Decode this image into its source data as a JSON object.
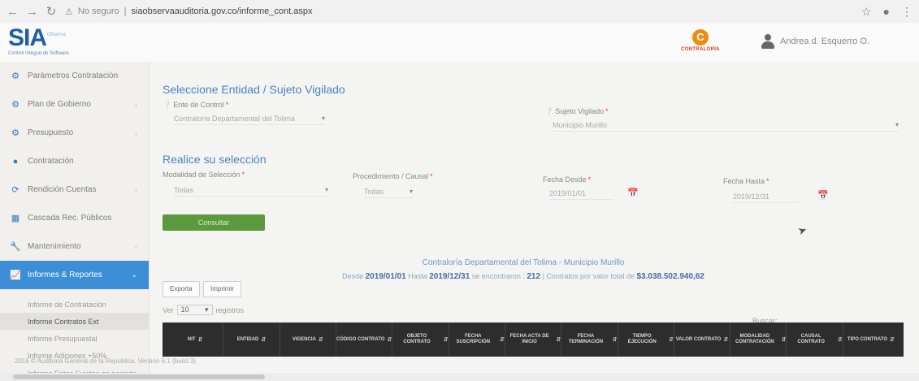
{
  "browser": {
    "security_label": "No seguro",
    "url": "siaobservaauditoria.gov.co/informe_cont.aspx"
  },
  "header": {
    "logo_text": "SIA",
    "logo_sub": "Observa",
    "logo_tagline": "Control Integral de Software",
    "contraloria_name": "CONTRALORIA",
    "user_name": "Andrea d. Esquerro O."
  },
  "sidebar": {
    "items": [
      {
        "label": "Parámetros Contratación",
        "icon": "gears-icon"
      },
      {
        "label": "Plan de Gobierno",
        "icon": "gears-icon"
      },
      {
        "label": "Presupuesto",
        "icon": "gears-icon"
      },
      {
        "label": "Contratación",
        "icon": "circle-icon"
      },
      {
        "label": "Rendición Cuentas",
        "icon": "refresh-icon"
      },
      {
        "label": "Cascada Rec. Públicos",
        "icon": "table-icon"
      },
      {
        "label": "Mantenimiento",
        "icon": "wrench-icon"
      },
      {
        "label": "Informes & Reportes",
        "icon": "chart-icon"
      }
    ],
    "subitems": [
      "Informe de Contratación",
      "Informe Contratos Ext",
      "Informe Presupuestal",
      "Informe Adiciones +50%",
      "Informe Entes Sujetos en periodo"
    ]
  },
  "main": {
    "section1_title": "Seleccione Entidad / Sujeto Vigilado",
    "ente_label": "Ente de Control",
    "ente_value": "Contraloría Departamental del Tolima",
    "sujeto_label": "Sujeto Vigilado",
    "sujeto_value": "Municipio Murillo",
    "section2_title": "Realice su selección",
    "modalidad_label": "Modalidad de Selección",
    "modalidad_value": "Todas",
    "procedimiento_label": "Procedimiento / Causal",
    "procedimiento_value": "Todas",
    "fecha_desde_label": "Fecha Desde",
    "fecha_desde_value": "2019/01/01",
    "fecha_hasta_label": "Fecha Hasta",
    "fecha_hasta_value": "2019/12/31",
    "consultar_label": "Consultar",
    "summary_title": "Contraloría Departamental del Tolima - Municipio Murillo",
    "summary_desde": "Desde",
    "summary_from": "2019/01/01",
    "summary_hasta": "Hasta",
    "summary_to": "2019/12/31",
    "summary_found": "se encontraron :",
    "summary_count": "212",
    "summary_total_text": "Contratos por valor total de",
    "summary_total": "$3.038.502.940,62",
    "export_label": "Exporta",
    "print_label": "Imprimir",
    "ver_label": "Ver",
    "ver_value": "10",
    "registros_label": "registros",
    "buscar_label": "Buscar:"
  },
  "table": {
    "headers": [
      "NIT",
      "ENTIDAD",
      "VIGENCIA",
      "CÓDIGO CONTRATO",
      "OBJETO CONTRATO",
      "FECHA SUSCRIPCIÓN",
      "FECHA ACTA DE INICIO",
      "FECHA TERMINACIÓN",
      "TIEMPO EJECUCIÓN",
      "VALOR CONTRATO",
      "MODALIDAD CONTRATACIÓN",
      "CAUSAL CONTRATO",
      "TIPO CONTRATO"
    ]
  },
  "footer": {
    "text": "2016 © Auditoria General de la República. Versión 6.1 (build 3)"
  },
  "colors": {
    "accent": "#3c8fd6",
    "title_blue": "#4a83c4",
    "consultar_green": "#5a9a3c",
    "table_header": "#2d2d2d"
  }
}
